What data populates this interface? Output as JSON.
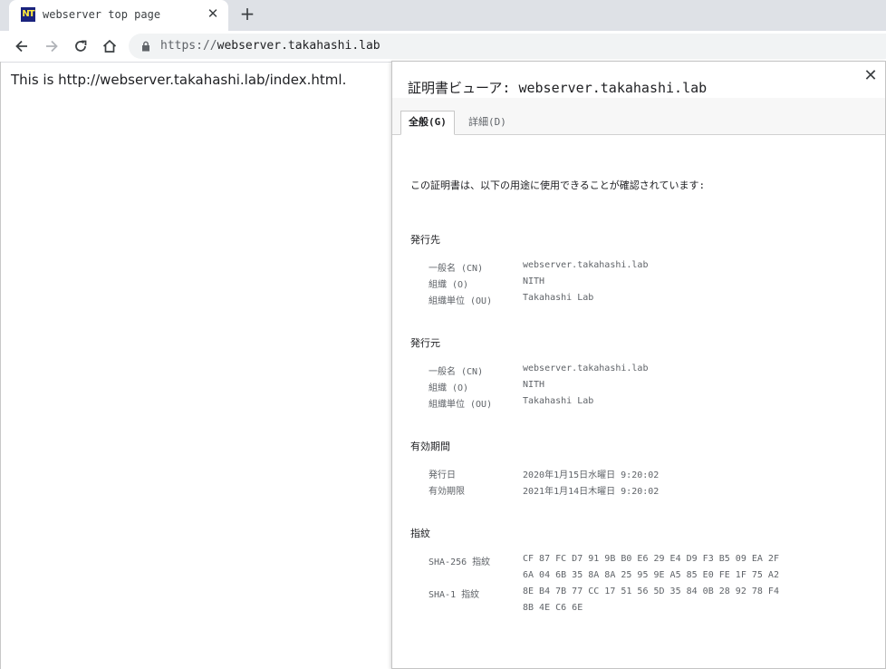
{
  "browser": {
    "tab": {
      "title": "webserver top page",
      "favicon_text": "NT"
    },
    "address": {
      "scheme": "https://",
      "host": "webserver.takahashi.lab"
    }
  },
  "page": {
    "text": "This is http://webserver.takahashi.lab/index.html."
  },
  "cert_viewer": {
    "title": "証明書ビューア: webserver.takahashi.lab",
    "tabs": [
      {
        "label": "全般(G)",
        "active": true
      },
      {
        "label": "詳細(D)",
        "active": false
      }
    ],
    "intro": "この証明書は、以下の用途に使用できることが確認されています:",
    "issued_to": {
      "heading": "発行先",
      "rows": [
        {
          "key": "一般名 (CN)",
          "value": "webserver.takahashi.lab"
        },
        {
          "key": "組織 (O)",
          "value": "NITH"
        },
        {
          "key": "組織単位 (OU)",
          "value": "Takahashi Lab"
        }
      ]
    },
    "issued_by": {
      "heading": "発行元",
      "rows": [
        {
          "key": "一般名 (CN)",
          "value": "webserver.takahashi.lab"
        },
        {
          "key": "組織 (O)",
          "value": "NITH"
        },
        {
          "key": "組織単位 (OU)",
          "value": "Takahashi Lab"
        }
      ]
    },
    "validity": {
      "heading": "有効期間",
      "rows": [
        {
          "key": "発行日",
          "value": "2020年1月15日水曜日 9:20:02"
        },
        {
          "key": "有効期限",
          "value": "2021年1月14日木曜日 9:20:02"
        }
      ]
    },
    "fingerprints": {
      "heading": "指紋",
      "sha256": {
        "key": "SHA-256 指紋",
        "line1": "CF 87 FC D7 91 9B B0 E6 29 E4 D9 F3 B5 09 EA 2F",
        "line2": "6A 04 6B 35 8A 8A 25 95 9E A5 85 E0 FE 1F 75 A2"
      },
      "sha1": {
        "key": "SHA-1 指紋",
        "line1": "8E B4 7B 77 CC 17 51 56 5D 35 84 0B 28 92 78 F4",
        "line2": "8B 4E C6 6E"
      }
    }
  },
  "colors": {
    "tabstrip_bg": "#dee1e6",
    "omnibox_bg": "#f1f3f4",
    "favicon_bg": "#1a237e",
    "favicon_fg": "#ffeb3b"
  }
}
